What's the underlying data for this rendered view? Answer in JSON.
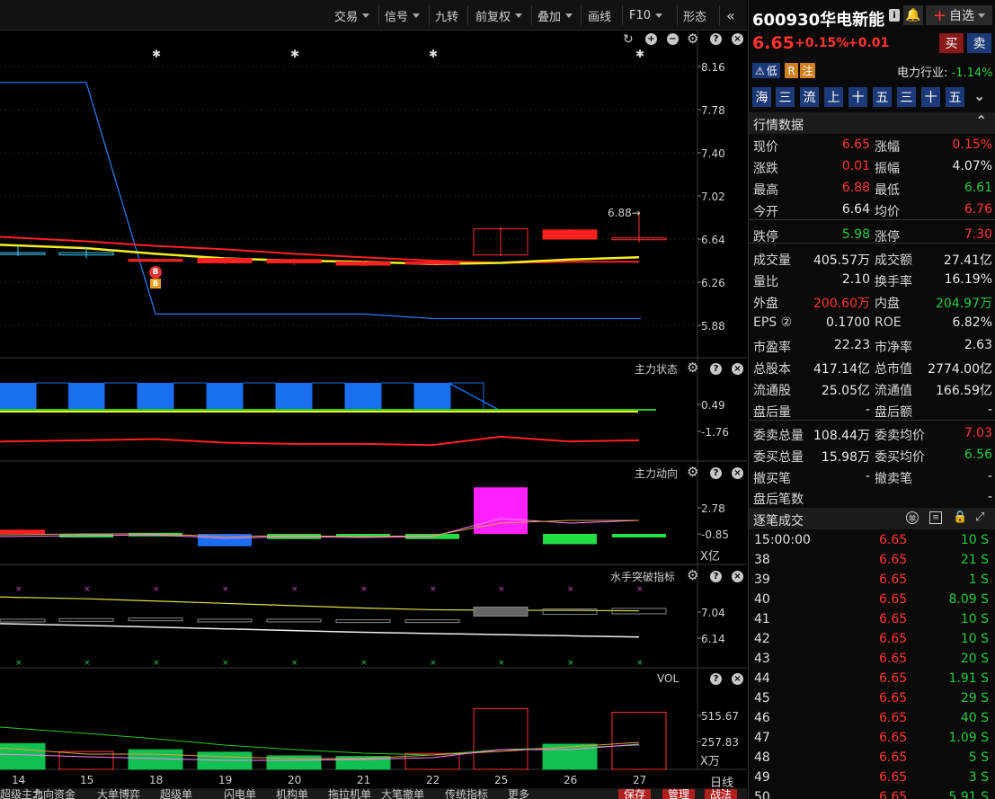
{
  "toolbar": {
    "buttons": [
      {
        "label": "交易",
        "dropdown": true
      },
      {
        "label": "信号",
        "dropdown": true
      },
      {
        "label": "九转",
        "dropdown": false
      },
      {
        "label": "前复权",
        "dropdown": true
      },
      {
        "label": "叠加",
        "dropdown": true
      },
      {
        "label": "画线",
        "dropdown": false
      },
      {
        "label": "F10",
        "dropdown": true
      },
      {
        "label": "形态",
        "dropdown": false
      }
    ],
    "collapse_icon": "double-chevron-left-icon"
  },
  "main_chart": {
    "price_axis": [
      "8.16",
      "7.78",
      "7.40",
      "7.02",
      "6.64",
      "6.26",
      "5.88"
    ],
    "high_label": "6.88",
    "signal_labels": [
      "B",
      "B"
    ]
  },
  "panels": {
    "state": {
      "title": "主力状态",
      "axis": [
        "0.49",
        "-1.76"
      ]
    },
    "flow": {
      "title": "主力动向",
      "axis": [
        "2.78",
        "-0.85"
      ],
      "unit": "X亿"
    },
    "breakout": {
      "title": "水手突破指标",
      "axis": [
        "7.04",
        "6.14"
      ]
    },
    "vol": {
      "title": "VOL",
      "axis": [
        "515.67",
        "257.83"
      ],
      "unit": "X万"
    }
  },
  "dates": [
    "14",
    "15",
    "18",
    "19",
    "20",
    "21",
    "22",
    "25",
    "26",
    "27"
  ],
  "period": "日线",
  "bottom_tabs": [
    "超级主力",
    "北向资金",
    "大单博弈",
    "超级单",
    "闪电单",
    "机构单",
    "拖拉机单",
    "大笔撤单",
    "传统指标",
    "更多"
  ],
  "bottom_buttons": {
    "save": "保存",
    "manage": "管理",
    "tactics": "战法"
  },
  "chart_data": {
    "type": "candlestick",
    "categories": [
      "14",
      "15",
      "18",
      "19",
      "20",
      "21",
      "22",
      "25",
      "26",
      "27"
    ],
    "price": {
      "ylim": [
        5.88,
        8.16
      ],
      "open": [
        6.52,
        6.5,
        6.46,
        6.47,
        6.46,
        6.44,
        6.44,
        6.5,
        6.72,
        6.64
      ],
      "close": [
        6.52,
        6.52,
        6.45,
        6.43,
        6.43,
        6.41,
        6.42,
        6.73,
        6.64,
        6.65
      ],
      "high": [
        6.58,
        6.57,
        6.47,
        6.48,
        6.47,
        6.45,
        6.45,
        6.75,
        6.73,
        6.88
      ],
      "low": [
        6.49,
        6.47,
        6.44,
        6.42,
        6.41,
        6.4,
        6.41,
        6.49,
        6.64,
        6.61
      ],
      "ma_yellow": [
        6.59,
        6.56,
        6.51,
        6.47,
        6.45,
        6.44,
        6.42,
        6.43,
        6.46,
        6.48
      ],
      "ma_red": [
        6.66,
        6.62,
        6.58,
        6.55,
        6.51,
        6.48,
        6.45,
        6.43,
        6.44,
        6.44
      ],
      "blue_line": [
        8.02,
        8.02,
        5.98,
        5.98,
        5.98,
        5.98,
        5.94,
        5.94,
        5.94,
        5.94
      ]
    },
    "state": {
      "values": [
        1,
        1,
        1,
        1,
        1,
        1,
        1,
        0,
        0,
        0
      ],
      "red_line": [
        -2.6,
        -2.5,
        -2.4,
        -2.7,
        -2.8,
        -2.8,
        -2.9,
        -2.2,
        -2.6,
        -2.5
      ]
    },
    "flow": {
      "values": [
        0.4,
        -0.3,
        0.1,
        -1.2,
        -0.5,
        -0.2,
        -0.5,
        4.5,
        -1.0,
        -0.1
      ],
      "ylim": [
        -1.6,
        5.0
      ]
    },
    "breakout": {
      "yellow": [
        7.56,
        7.5,
        7.42,
        7.34,
        7.26,
        7.18,
        7.12,
        7.1,
        7.1,
        7.08
      ],
      "white": [
        6.64,
        6.58,
        6.52,
        6.46,
        6.4,
        6.34,
        6.3,
        6.26,
        6.22,
        6.18
      ],
      "box": [
        6.7,
        6.72,
        6.74,
        6.7,
        6.7,
        6.68,
        6.68,
        6.9,
        6.96,
        6.98
      ]
    },
    "vol": {
      "values": [
        210,
        145,
        160,
        140,
        110,
        105,
        130,
        495,
        205,
        465
      ],
      "up": [
        false,
        true,
        false,
        false,
        false,
        false,
        true,
        true,
        false,
        true
      ],
      "ylim": [
        0,
        600
      ]
    }
  },
  "quote": {
    "code": "600930",
    "name": "华电新能",
    "price": "6.65",
    "pct": "+0.15%",
    "change": "+0.01",
    "buy": "买",
    "sell": "卖",
    "add_watch": "自选",
    "tag_low": "低",
    "tag_r": "R",
    "tag_note": "注",
    "industry_label": "电力行业:",
    "industry_pct": "-1.14%",
    "nav": [
      "海",
      "三",
      "流",
      "上",
      "十",
      "五",
      "三",
      "十",
      "五"
    ]
  },
  "market_header": "行情数据",
  "market": [
    {
      "l1": "现价",
      "v1": "6.65",
      "c1": "red",
      "l2": "涨幅",
      "v2": "0.15%",
      "c2": "red"
    },
    {
      "l1": "涨跌",
      "v1": "0.01",
      "c1": "red",
      "l2": "振幅",
      "v2": "4.07%",
      "c2": "white"
    },
    {
      "l1": "最高",
      "v1": "6.88",
      "c1": "red",
      "l2": "最低",
      "v2": "6.61",
      "c2": "green"
    },
    {
      "l1": "今开",
      "v1": "6.64",
      "c1": "white",
      "l2": "均价",
      "v2": "6.76",
      "c2": "red"
    },
    {
      "l1": "跌停",
      "v1": "5.98",
      "c1": "green",
      "l2": "涨停",
      "v2": "7.30",
      "c2": "red"
    },
    {
      "l1": "成交量",
      "v1": "405.57万",
      "c1": "white",
      "l2": "成交额",
      "v2": "27.41亿",
      "c2": "white"
    },
    {
      "l1": "量比",
      "v1": "2.10",
      "c1": "white",
      "l2": "换手率",
      "v2": "16.19%",
      "c2": "white"
    },
    {
      "l1": "外盘",
      "v1": "200.60万",
      "c1": "red",
      "l2": "内盘",
      "v2": "204.97万",
      "c2": "green"
    },
    {
      "l1": "EPS ②",
      "v1": "0.1700",
      "c1": "white",
      "l2": "ROE",
      "v2": "6.82%",
      "c2": "white"
    },
    {
      "l1": "市盈率",
      "v1": "22.23",
      "c1": "white",
      "l2": "市净率",
      "v2": "2.63",
      "c2": "white"
    },
    {
      "l1": "总股本",
      "v1": "417.14亿",
      "c1": "white",
      "l2": "总市值",
      "v2": "2774.00亿",
      "c2": "white"
    },
    {
      "l1": "流通股",
      "v1": "25.05亿",
      "c1": "white",
      "l2": "流通值",
      "v2": "166.59亿",
      "c2": "white"
    },
    {
      "l1": "盘后量",
      "v1": "-",
      "c1": "white",
      "l2": "盘后额",
      "v2": "-",
      "c2": "white"
    },
    {
      "l1": "委卖总量",
      "v1": "108.44万",
      "c1": "white",
      "l2": "委卖均价",
      "v2": "7.03",
      "c2": "red"
    },
    {
      "l1": "委买总量",
      "v1": "15.98万",
      "c1": "white",
      "l2": "委买均价",
      "v2": "6.56",
      "c2": "green"
    },
    {
      "l1": "撤买笔",
      "v1": "-",
      "c1": "white",
      "l2": "撤卖笔",
      "v2": "-",
      "c2": "white"
    },
    {
      "l1": "盘后笔数",
      "v1": "",
      "c1": "white",
      "l2": "",
      "v2": "-",
      "c2": "white"
    }
  ],
  "ticks_header": "逐笔成交",
  "ticks": [
    {
      "t": "15:00:00",
      "p": "6.65",
      "q": "10 S"
    },
    {
      "t": "38",
      "p": "6.65",
      "q": "21 S"
    },
    {
      "t": "39",
      "p": "6.65",
      "q": "1 S"
    },
    {
      "t": "40",
      "p": "6.65",
      "q": "8.09 S"
    },
    {
      "t": "41",
      "p": "6.65",
      "q": "10 S"
    },
    {
      "t": "42",
      "p": "6.65",
      "q": "10 S"
    },
    {
      "t": "43",
      "p": "6.65",
      "q": "20 S"
    },
    {
      "t": "44",
      "p": "6.65",
      "q": "1.91 S"
    },
    {
      "t": "45",
      "p": "6.65",
      "q": "29 S"
    },
    {
      "t": "46",
      "p": "6.65",
      "q": "40 S"
    },
    {
      "t": "47",
      "p": "6.65",
      "q": "1.09 S"
    },
    {
      "t": "48",
      "p": "6.65",
      "q": "5 S"
    },
    {
      "t": "49",
      "p": "6.65",
      "q": "3 S"
    },
    {
      "t": "50",
      "p": "6.65",
      "q": "5.91 S"
    }
  ]
}
